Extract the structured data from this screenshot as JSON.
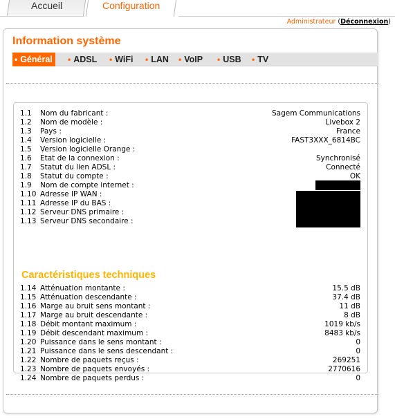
{
  "tabs": [
    {
      "label": "Accueil"
    },
    {
      "label": "Configuration"
    }
  ],
  "admin_bar": {
    "user": "Administrateur",
    "open": "(",
    "logout": "Déconnexion",
    "close": ")"
  },
  "panel": {
    "title": "Information système"
  },
  "subnav": [
    {
      "label": "Général"
    },
    {
      "label": "ADSL"
    },
    {
      "label": "WiFi"
    },
    {
      "label": "LAN"
    },
    {
      "label": "VoIP"
    },
    {
      "label": "USB"
    },
    {
      "label": "TV"
    }
  ],
  "general": [
    {
      "num": "1.1",
      "label": "Nom du fabricant :",
      "value": "Sagem Communications"
    },
    {
      "num": "1.2",
      "label": "Nom de modèle :",
      "value": "Livebox 2"
    },
    {
      "num": "1.3",
      "label": "Pays :",
      "value": "France"
    },
    {
      "num": "1.4",
      "label": "Version logicielle :",
      "value": "FAST3XXX_6814BC"
    },
    {
      "num": "1.5",
      "label": "Version logicielle Orange :",
      "value": ""
    },
    {
      "num": "1.6",
      "label": "Etat de la connexion :",
      "value": "Synchronisé"
    },
    {
      "num": "1.7",
      "label": "Statut du lien ADSL :",
      "value": "Connecté"
    },
    {
      "num": "1.8",
      "label": "Statut du compte :",
      "value": "OK"
    },
    {
      "num": "1.9",
      "label": "Nom de compte internet :",
      "value": ""
    },
    {
      "num": "1.10",
      "label": "Adresse IP WAN :",
      "value": ""
    },
    {
      "num": "1.11",
      "label": "Adresse IP du BAS :",
      "value": ""
    },
    {
      "num": "1.12",
      "label": "Serveur DNS primaire :",
      "value": ""
    },
    {
      "num": "1.13",
      "label": "Serveur DNS secondaire :",
      "value": ""
    }
  ],
  "tech_title": "Caractéristiques techniques",
  "tech": [
    {
      "num": "1.14",
      "label": "Atténuation montante :",
      "value": "15.5 dB"
    },
    {
      "num": "1.15",
      "label": "Atténuation descendante :",
      "value": "37.4 dB"
    },
    {
      "num": "1.16",
      "label": "Marge au bruit sens montant :",
      "value": "11 dB"
    },
    {
      "num": "1.17",
      "label": "Marge au bruit descendante :",
      "value": "8 dB"
    },
    {
      "num": "1.18",
      "label": "Débit montant maximum :",
      "value": "1019 kb/s"
    },
    {
      "num": "1.19",
      "label": "Débit descendant maximum :",
      "value": "8483 kb/s"
    },
    {
      "num": "1.20",
      "label": "Puissance dans le sens montant :",
      "value": "0"
    },
    {
      "num": "1.21",
      "label": "Puissance dans le sens descendant :",
      "value": "0"
    },
    {
      "num": "1.22",
      "label": "Nombre de paquets reçus :",
      "value": "269251"
    },
    {
      "num": "1.23",
      "label": "Nombre de paquets envoyés :",
      "value": "2770616"
    },
    {
      "num": "1.24",
      "label": "Nombre de paquets perdus :",
      "value": "0"
    }
  ]
}
